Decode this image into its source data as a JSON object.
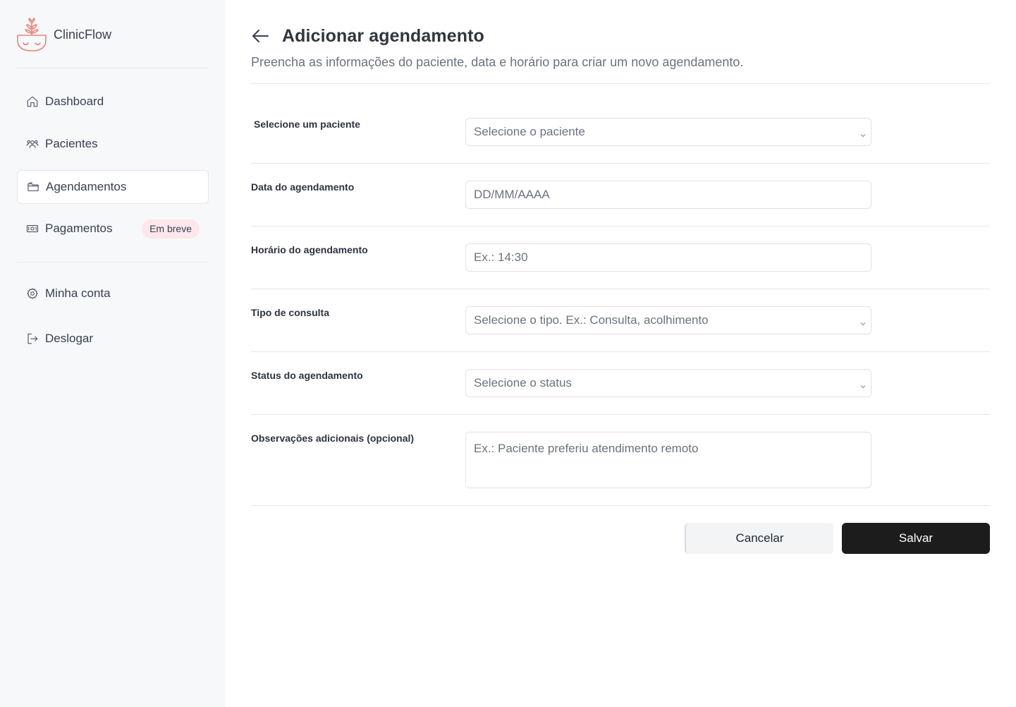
{
  "brand": {
    "name": "ClinicFlow",
    "logo_color": "#e8857a"
  },
  "sidebar": {
    "items": [
      {
        "label": "Dashboard",
        "icon": "home-icon"
      },
      {
        "label": "Pacientes",
        "icon": "users-icon"
      },
      {
        "label": "Agendamentos",
        "icon": "folder-icon",
        "active": true
      },
      {
        "label": "Pagamentos",
        "icon": "money-icon",
        "badge": "Em breve"
      },
      {
        "label": "Minha conta",
        "icon": "gear-icon"
      },
      {
        "label": "Deslogar",
        "icon": "logout-icon"
      }
    ]
  },
  "page": {
    "title": "Adicionar agendamento",
    "subtitle": "Preencha as informações do paciente, data e horário para criar um novo agendamento."
  },
  "form": {
    "patient": {
      "label": "Selecione um paciente",
      "placeholder": "Selecione o paciente"
    },
    "date": {
      "label": "Data do agendamento",
      "placeholder": "DD/MM/AAAA"
    },
    "time": {
      "label": "Horário do agendamento",
      "placeholder": "Ex.: 14:30"
    },
    "type": {
      "label": "Tipo de consulta",
      "placeholder": "Selecione o tipo. Ex.: Consulta, acolhimento"
    },
    "status": {
      "label": "Status do agendamento",
      "placeholder": "Selecione o status"
    },
    "notes": {
      "label": "Observações adicionais (opcional)",
      "placeholder": "Ex.: Paciente preferiu atendimento remoto"
    }
  },
  "actions": {
    "cancel_label": "Cancelar",
    "save_label": "Salvar"
  },
  "colors": {
    "badge_bg": "#fde7ec",
    "save_bg": "#1c1c1c",
    "sidebar_bg": "#f7f8fa"
  }
}
